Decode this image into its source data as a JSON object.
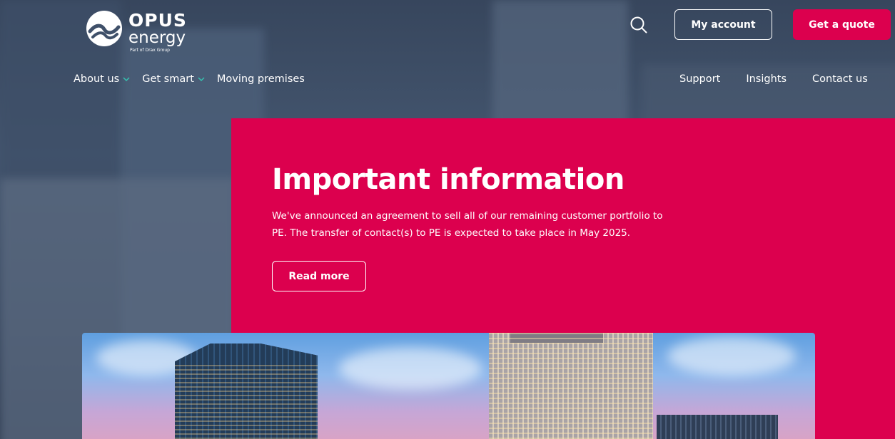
{
  "header": {
    "logo": {
      "brand": "OPUS",
      "brand_sub": "energy",
      "tagline": "Part of Drax Group"
    },
    "search_icon": "search-icon",
    "my_account_label": "My account",
    "get_quote_label": "Get a quote"
  },
  "nav_left": [
    {
      "label": "About us",
      "has_dropdown": true
    },
    {
      "label": "Get smart",
      "has_dropdown": true
    },
    {
      "label": "Moving premises",
      "has_dropdown": false
    }
  ],
  "nav_right": [
    {
      "label": "Support"
    },
    {
      "label": "Insights"
    },
    {
      "label": "Contact us"
    }
  ],
  "notice": {
    "title": "Important information",
    "body": "We've announced an agreement to sell all of our remaining customer portfolio to PE. The transfer of contact(s) to PE is expected to take place in May 2025.",
    "button_label": "Read more"
  },
  "colors": {
    "brand_accent": "#dc004e",
    "nav_chevron": "#35c2b0"
  }
}
